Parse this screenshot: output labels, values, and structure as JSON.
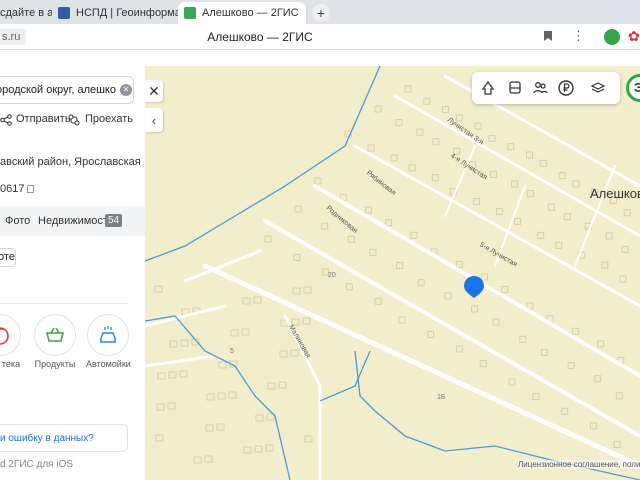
{
  "browser": {
    "tabs": [
      {
        "label": "сдайте в ар"
      },
      {
        "label": "НСПД | Геоинформацион"
      },
      {
        "label": "Алешково — 2ГИС"
      }
    ],
    "new_tab_label": "+",
    "close_label": "✕",
    "address_chip": "s.ru",
    "page_title": "Алешково — 2ГИС"
  },
  "panel": {
    "search_value": "ь городской округ, алешко",
    "share_label": "Отправить",
    "route_label": "Проехать",
    "address": "авский район, Ярославская",
    "code": "0617",
    "tabs": {
      "photo": "Фото",
      "realty": "Недвижимость",
      "realty_count": "54"
    },
    "chip_label": "оте",
    "categories": [
      {
        "label": "тека"
      },
      {
        "label": "Продукты"
      },
      {
        "label": "Автомойки"
      }
    ],
    "error_link": "и ошибку в данных?",
    "footer": "d    2ГИС для iOS"
  },
  "map": {
    "place_label": "Алешково",
    "user_initial": "Э",
    "streets": [
      {
        "label": "Лучистая 3-я"
      },
      {
        "label": "4-я Лучистая"
      },
      {
        "label": "Рябиновая"
      },
      {
        "label": "Родниковая"
      },
      {
        "label": "5-я Лучистая"
      },
      {
        "label": "Малиновая"
      }
    ],
    "house_numbers": [
      "20",
      "5",
      "1Б"
    ],
    "license": "Лицензионное соглашение, полити"
  },
  "colors": {
    "map_bg": "#f2edcb",
    "road": "#ffffff",
    "water": "#4b9bdb",
    "pin": "#1a73e8",
    "accent_green": "#2fa84f"
  }
}
